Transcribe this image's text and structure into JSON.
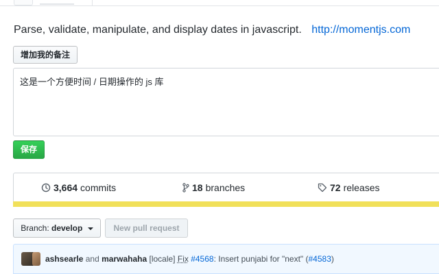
{
  "repo": {
    "description": "Parse, validate, manipulate, and display dates in javascript.",
    "homepage": "http://momentjs.com"
  },
  "note": {
    "add_button_label": "增加我的备注",
    "text": "这是一个方便时间 / 日期操作的 js 库",
    "save_button_label": "保存"
  },
  "summary": {
    "commits_count": "3,664",
    "commits_label": "commits",
    "branches_count": "18",
    "branches_label": "branches",
    "releases_count": "72",
    "releases_label": "releases"
  },
  "language_bar": {
    "color": "#f1e05a"
  },
  "branch": {
    "prefix": "Branch:",
    "name": "develop"
  },
  "new_pr_label": "New pull request",
  "latest_commit": {
    "author1": "ashsearle",
    "and_word": "and",
    "author2": "marwahaha",
    "prefix": "[locale]",
    "fix_word": "Fix",
    "issue": "#4568",
    "message": ": Insert punjabi for \"next\" (",
    "pr": "#4583",
    "suffix": ")"
  }
}
